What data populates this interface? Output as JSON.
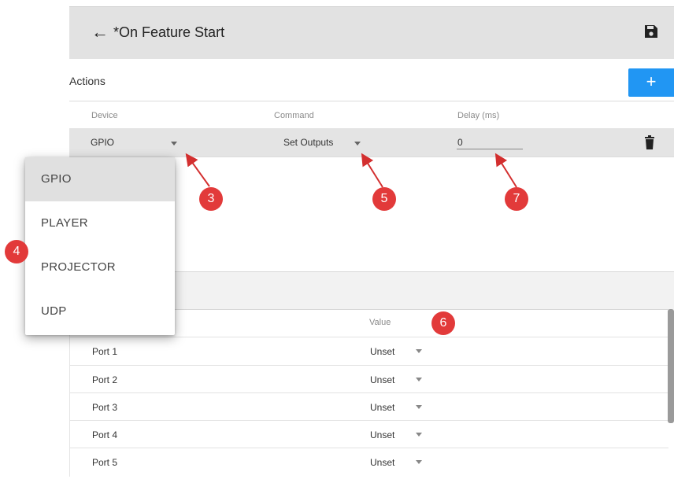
{
  "header": {
    "title": "*On Feature Start",
    "back_icon": "arrow-left-icon",
    "save_icon": "save-disk-icon"
  },
  "actions": {
    "label": "Actions",
    "add_label": "+",
    "columns": [
      "Device",
      "Command",
      "Delay (ms)"
    ],
    "row": {
      "device": "GPIO",
      "command": "Set Outputs",
      "delay": "0"
    }
  },
  "device_dropdown": {
    "options": [
      "GPIO",
      "PLAYER",
      "PROJECTOR",
      "UDP"
    ],
    "selected": "GPIO"
  },
  "ports": {
    "value_header": "Value",
    "rows": [
      {
        "name": "Port 1",
        "value": "Unset"
      },
      {
        "name": "Port 2",
        "value": "Unset"
      },
      {
        "name": "Port 3",
        "value": "Unset"
      },
      {
        "name": "Port 4",
        "value": "Unset"
      },
      {
        "name": "Port 5",
        "value": "Unset"
      }
    ]
  },
  "callouts": [
    "3",
    "4",
    "5",
    "6",
    "7"
  ],
  "colors": {
    "accent": "#2196f3",
    "callout": "#e23a3a",
    "header_bg": "#e2e2e2"
  }
}
